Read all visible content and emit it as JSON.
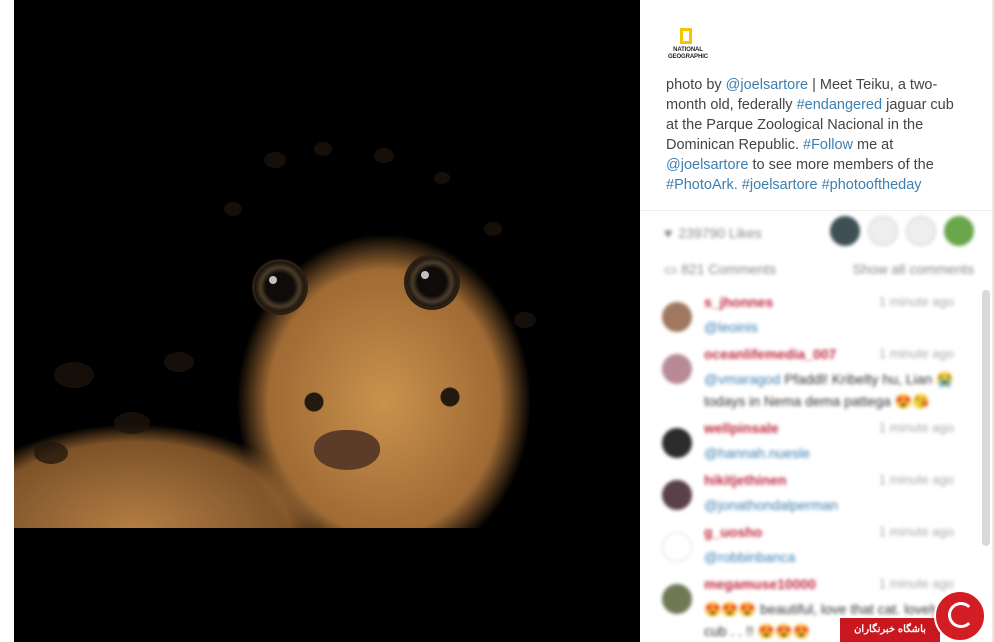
{
  "post": {
    "image_alt": "Jaguar cub portrait",
    "logo_text": "NATIONAL GEOGRAPHIC",
    "caption": {
      "t1": "photo by ",
      "mention1": "@joelsartore",
      "t2": " | Meet Teiku, a two-month old, federally ",
      "tag1": "#endangered",
      "t3": " jaguar cub at the Parque Zoological Nacional in the Dominican Republic. ",
      "tag2": "#Follow",
      "t4": " me at ",
      "mention2": "@joelsartore",
      "t5": " to see more members of the ",
      "tag3": "#PhotoArk.",
      "t6": " ",
      "tag4": "#joelsartore",
      "t7": " ",
      "tag5": "#photooftheday"
    }
  },
  "stats": {
    "likes": "239790 Likes",
    "comments": "821 Comments",
    "show_all": "Show all comments"
  },
  "comments": [
    {
      "user": "s_jhonnes",
      "time": "1 minute ago",
      "body_mention": "@leoinis",
      "body_text": ""
    },
    {
      "user": "oceanlifemedia_007",
      "time": "1 minute ago",
      "body_mention": "@vmaragod",
      "body_text": " Pfaddl! Kribelty hu, Lian 😭 todays in Nema dema pattega 😍😘"
    },
    {
      "user": "wellpinsale",
      "time": "1 minute ago",
      "body_mention": "@hannah.nuesle",
      "body_text": ""
    },
    {
      "user": "hikitjethinen",
      "time": "1 minute ago",
      "body_mention": "@jonathondalperman",
      "body_text": ""
    },
    {
      "user": "g_uosho",
      "time": "1 minute ago",
      "body_mention": "@robbinbanca",
      "body_text": ""
    },
    {
      "user": "megamuse10000",
      "time": "1 minute ago",
      "body_mention": "",
      "body_text": "😍😍😍 beautiful, love that cat. lovely cub . . !! 😍😍😍"
    }
  ],
  "watermark": {
    "text": "باشگاه خبرنگاران"
  },
  "colors": {
    "link": "#3c7fb1",
    "username": "#c0283e",
    "logo_yellow": "#f5c400",
    "watermark_red": "#c8171f"
  }
}
